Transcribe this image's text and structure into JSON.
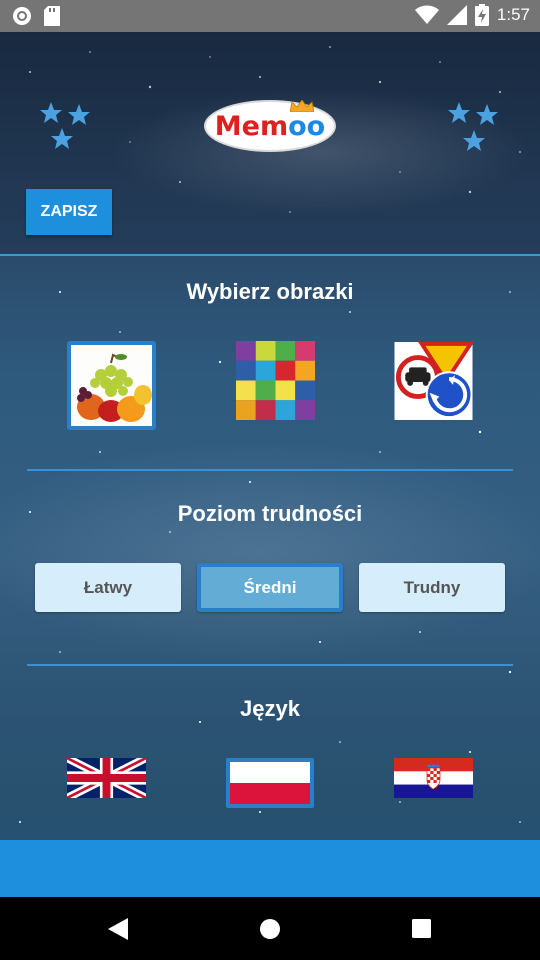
{
  "status_bar": {
    "time": "1:57",
    "icons": [
      "record-icon",
      "sd-card-icon",
      "wifi-icon",
      "cellular-signal-icon",
      "battery-charging-icon"
    ]
  },
  "header": {
    "logo_text_part1": "Mem",
    "logo_text_part2": "oo",
    "save_label": "ZAPISZ"
  },
  "images_section": {
    "title": "Wybierz obrazki",
    "options": [
      {
        "name": "fruits",
        "selected": true
      },
      {
        "name": "colors",
        "selected": false
      },
      {
        "name": "road-signs",
        "selected": false
      }
    ]
  },
  "difficulty_section": {
    "title": "Poziom trudności",
    "options": [
      {
        "label": "Łatwy",
        "selected": false
      },
      {
        "label": "Średni",
        "selected": true
      },
      {
        "label": "Trudny",
        "selected": false
      }
    ]
  },
  "language_section": {
    "title": "Język",
    "options": [
      {
        "name": "english-flag",
        "selected": false
      },
      {
        "name": "polish-flag",
        "selected": true
      },
      {
        "name": "croatian-flag",
        "selected": false
      }
    ]
  },
  "colors": {
    "accent": "#1e8fdc",
    "selected_border": "#2a7fc6",
    "button_bg": "#d6eefb",
    "button_active_bg": "#62acd6"
  },
  "nav_bar": {
    "buttons": [
      "back-icon",
      "home-icon",
      "recents-icon"
    ]
  }
}
